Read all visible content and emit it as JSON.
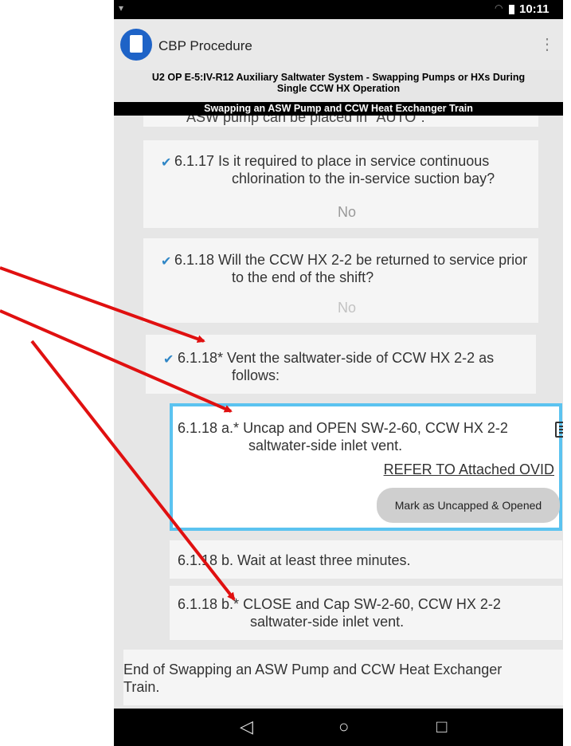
{
  "status": {
    "time": "10:11"
  },
  "app": {
    "title": "CBP Procedure",
    "overflow": "⋮"
  },
  "procedure": {
    "title_line1": "U2 OP E-5:IV-R12 Auxiliary Saltwater System - Swapping Pumps or HXs During",
    "title_line2": "Single CCW HX Operation",
    "section": "Swapping an ASW Pump and CCW Heat Exchanger Train",
    "partial_step": "ASW pump can be placed in \"AUTO\"."
  },
  "steps": [
    {
      "number_text": "6.1.17",
      "line1": "6.1.17 Is it required to place in service continuous",
      "line2": "chlorination to the in-service suction bay?",
      "answer": "No",
      "check": "✔"
    },
    {
      "number_text": "6.1.18",
      "line1": "6.1.18 Will the CCW HX 2-2 be returned to service prior",
      "line2": "to the end of the shift?",
      "answer": "No",
      "check": "✔"
    },
    {
      "number_text": "6.1.18*",
      "line1": "6.1.18* Vent the saltwater-side of CCW HX 2-2 as",
      "line2": "follows:",
      "check": "✔"
    },
    {
      "number_text": "6.1.18 a.*",
      "line1": "6.1.18 a.* Uncap and OPEN SW-2-60, CCW HX 2-2",
      "line2": "saltwater-side inlet vent.",
      "refer": "REFER TO Attached OVID",
      "button": "Mark as Uncapped & Opened"
    },
    {
      "number_text": "6.1.18 b.",
      "line1": "6.1.18 b. Wait at least three minutes."
    },
    {
      "number_text": "6.1.18 b.*",
      "line1": "6.1.18 b.* CLOSE and Cap SW-2-60, CCW HX 2-2",
      "line2": "saltwater-side inlet vent."
    }
  ],
  "end": {
    "line1": "End of Swapping an ASW Pump and CCW Heat Exchanger",
    "line2": "Train."
  },
  "nav": {
    "back": "◁",
    "home": "○",
    "recents": "□"
  },
  "colors": {
    "accent": "#1e63c7",
    "check": "#2f86c6",
    "highlight_border": "#5bc3f0",
    "arrow": "#e01010"
  }
}
